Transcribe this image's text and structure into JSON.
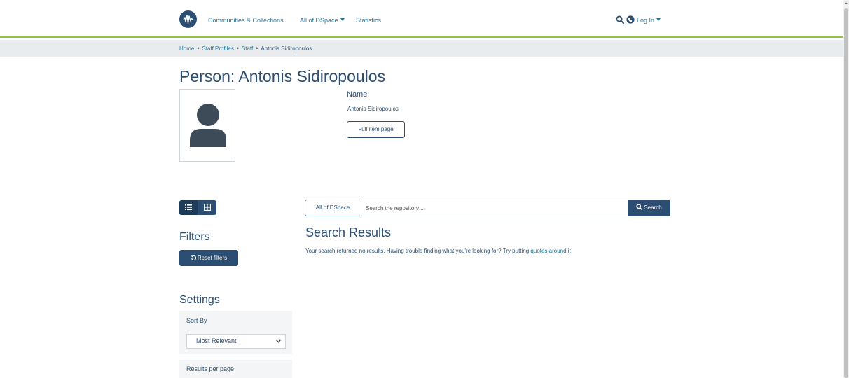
{
  "header": {
    "nav": {
      "communities": "Communities & Collections",
      "all_dspace": "All of DSpace",
      "statistics": "Statistics"
    },
    "login": "Log In"
  },
  "breadcrumb": {
    "home": "Home",
    "staff_profiles": "Staff Profiles",
    "staff": "Staff",
    "current": "Antonis Sidiropoulos"
  },
  "item": {
    "title": "Person: Antonis Sidiropoulos",
    "name_label": "Name",
    "name_value": "Antonis Sidiropoulos",
    "full_item_button": "Full item page"
  },
  "search": {
    "scope_label": "All of DSpace",
    "placeholder": "Search the repository ...",
    "button": "Search"
  },
  "filters": {
    "heading": "Filters",
    "reset": "Reset filters"
  },
  "results": {
    "heading": "Search Results",
    "message": "Your search returned no results. Having trouble finding what you're looking for? Try putting ",
    "link": "quotes around it"
  },
  "settings": {
    "heading": "Settings",
    "sort_label": "Sort By",
    "sort_value": "Most Relevant",
    "rpp_label": "Results per page"
  },
  "colors": {
    "primary": "#2b4e72",
    "link": "#207698",
    "accent": "#92c642"
  }
}
